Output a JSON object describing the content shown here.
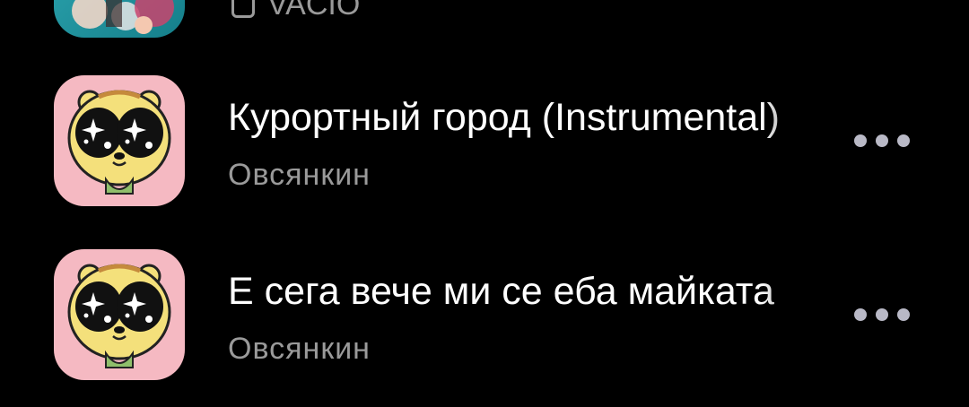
{
  "tracks": [
    {
      "subtitle": "VACIO",
      "art_icon": "album-art-blue-photo",
      "explicit_icon": "explicit-icon"
    },
    {
      "title": "Курортный город (Instrumental)",
      "subtitle": "Овсянкин",
      "art_icon": "album-art-cartoon-bear",
      "more_icon": "more-options-icon"
    },
    {
      "title": "Е сега вече ми се еба майката",
      "subtitle": "Овсянкин",
      "art_icon": "album-art-cartoon-bear",
      "more_icon": "more-options-icon"
    }
  ],
  "colors": {
    "background": "#000000",
    "title": "#ffffff",
    "subtitle": "#9a9a9a",
    "more_dots": "#b9b9c6"
  }
}
